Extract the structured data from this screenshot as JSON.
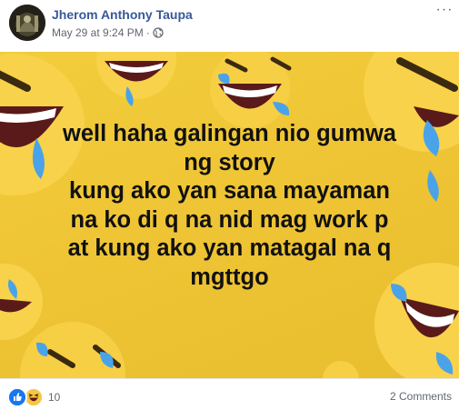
{
  "post": {
    "author": "Jherom Anthony Taupa",
    "timestamp": "May 29 at 9:24 PM",
    "separator": "·",
    "privacy_icon": "globe-icon",
    "more_icon": "more-options-icon",
    "more_label": "···"
  },
  "media": {
    "background_color": "#efc535",
    "lines": [
      "well haha galingan nio gumwa",
      "ng story",
      "kung ako yan sana mayaman",
      "na ko di q na nid mag work p",
      "at kung ako yan matagal na q",
      "mgttgo"
    ]
  },
  "footer": {
    "reaction_icons": [
      "like-icon",
      "haha-icon"
    ],
    "reaction_count": "10",
    "comments_label": "2 Comments"
  },
  "colors": {
    "author_link": "#385898",
    "meta_text": "#616770",
    "like_blue": "#1877f2",
    "haha_yellow": "#f7c744"
  }
}
